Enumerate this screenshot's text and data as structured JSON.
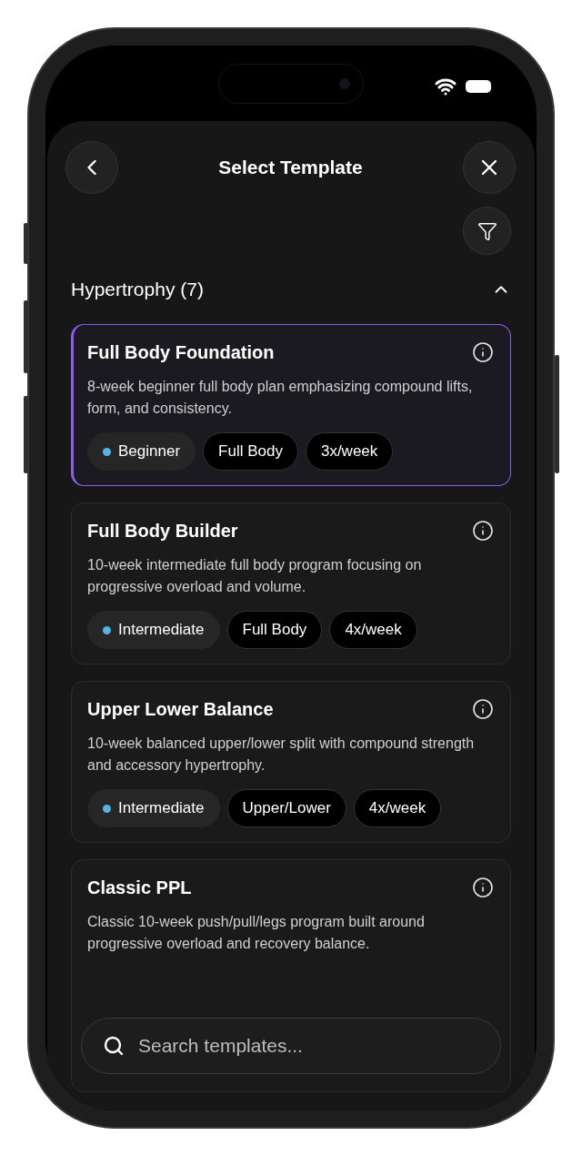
{
  "header": {
    "title": "Select Template"
  },
  "section": {
    "title": "Hypertrophy (7)",
    "expanded": true
  },
  "templates": [
    {
      "title": "Full Body Foundation",
      "description": "8-week beginner full body plan emphasizing compound lifts, form, and consistency.",
      "selected": true,
      "tags": [
        {
          "kind": "level",
          "label": "Beginner",
          "color": "#4fb3e8"
        },
        {
          "kind": "plain",
          "label": "Full Body"
        },
        {
          "kind": "plain",
          "label": "3x/week"
        }
      ]
    },
    {
      "title": "Full Body Builder",
      "description": "10-week intermediate full body program focusing on progressive overload and volume.",
      "selected": false,
      "tags": [
        {
          "kind": "level",
          "label": "Intermediate",
          "color": "#4fb3e8"
        },
        {
          "kind": "plain",
          "label": "Full Body"
        },
        {
          "kind": "plain",
          "label": "4x/week"
        }
      ]
    },
    {
      "title": "Upper Lower Balance",
      "description": "10-week balanced upper/lower split with compound strength and accessory hypertrophy.",
      "selected": false,
      "tags": [
        {
          "kind": "level",
          "label": "Intermediate",
          "color": "#4fb3e8"
        },
        {
          "kind": "plain",
          "label": "Upper/Lower"
        },
        {
          "kind": "plain",
          "label": "4x/week"
        }
      ]
    },
    {
      "title": "Classic PPL",
      "description": "Classic 10-week push/pull/legs program built around progressive overload and recovery balance.",
      "selected": false
    }
  ],
  "search": {
    "placeholder": "Search templates..."
  }
}
